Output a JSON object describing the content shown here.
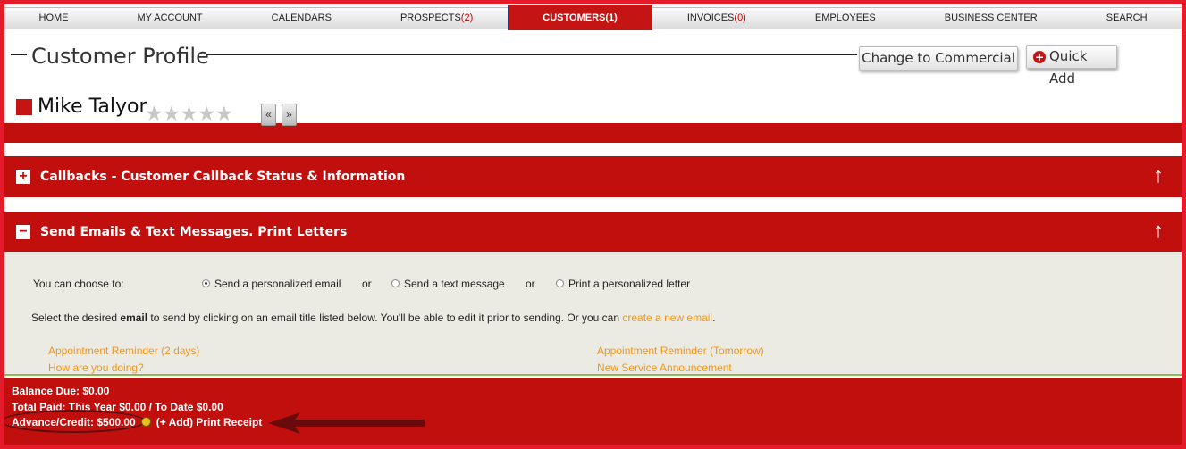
{
  "nav": {
    "items": [
      {
        "label": "HOME",
        "count": ""
      },
      {
        "label": "MY ACCOUNT",
        "count": ""
      },
      {
        "label": "CALENDARS",
        "count": ""
      },
      {
        "label": "PROSPECTS",
        "count": "(2)"
      },
      {
        "label": "CUSTOMERS",
        "count": "(1)"
      },
      {
        "label": "INVOICES",
        "count": "(0)"
      },
      {
        "label": "EMPLOYEES",
        "count": ""
      },
      {
        "label": "BUSINESS CENTER",
        "count": ""
      },
      {
        "label": "SEARCH",
        "count": ""
      }
    ],
    "active_index": 4
  },
  "header": {
    "title": "Customer Profile",
    "change_button": "Change to Commercial",
    "quick_add_button": "Quick Add"
  },
  "customer": {
    "name": "Mike Talyor",
    "stars": "★★★★★",
    "prev": "«",
    "next": "»"
  },
  "sections": {
    "callbacks_title": "Callbacks - Customer Callback Status & Information",
    "emails_title": "Send Emails & Text Messages. Print Letters"
  },
  "email_panel": {
    "choose_label": "You can choose to:",
    "option_email": "Send a personalized email",
    "or1": "or",
    "option_text": "Send a text message",
    "or2": "or",
    "option_letter": "Print a personalized letter",
    "instr_prefix": "Select the desired ",
    "instr_bold": "email",
    "instr_middle": " to send by clicking on an email title listed below. You'll be able to edit it prior to sending. Or you can ",
    "instr_link": "create a new email",
    "instr_suffix": ".",
    "templates": [
      "Appointment Reminder (2 days)",
      "How are you doing?",
      "Appointment Reminder (Tomorrow)",
      "New Service Announcement"
    ]
  },
  "footer": {
    "balance_due": "Balance Due: $0.00",
    "total_paid": "Total Paid: This Year $0.00 / To Date $0.00",
    "advance_credit": "Advance/Credit: $500.00",
    "add_link": "(+ Add)",
    "print_receipt": "Print Receipt"
  }
}
